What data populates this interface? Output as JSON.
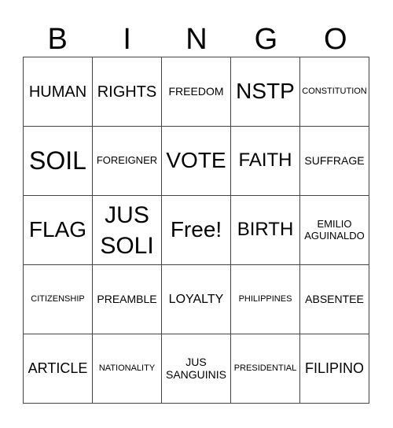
{
  "header": {
    "letters": [
      "B",
      "I",
      "N",
      "G",
      "O"
    ]
  },
  "card": {
    "rows": [
      [
        "HUMAN",
        "RIGHTS",
        "FREEDOM",
        "NSTP",
        "CONSTITUTION"
      ],
      [
        "SOIL",
        "FOREIGNER",
        "VOTE",
        "FAITH",
        "SUFFRAGE"
      ],
      [
        "FLAG",
        "JUS SOLI",
        "Free!",
        "BIRTH",
        "EMILIO AGUINALDO"
      ],
      [
        "CITIZENSHIP",
        "PREAMBLE",
        "LOYALTY",
        "PHILIPPINES",
        "ABSENTEE"
      ],
      [
        "ARTICLE",
        "NATIONALITY",
        "JUS SANGUINIS",
        "PRESIDENTIAL",
        "FILIPINO"
      ]
    ]
  }
}
